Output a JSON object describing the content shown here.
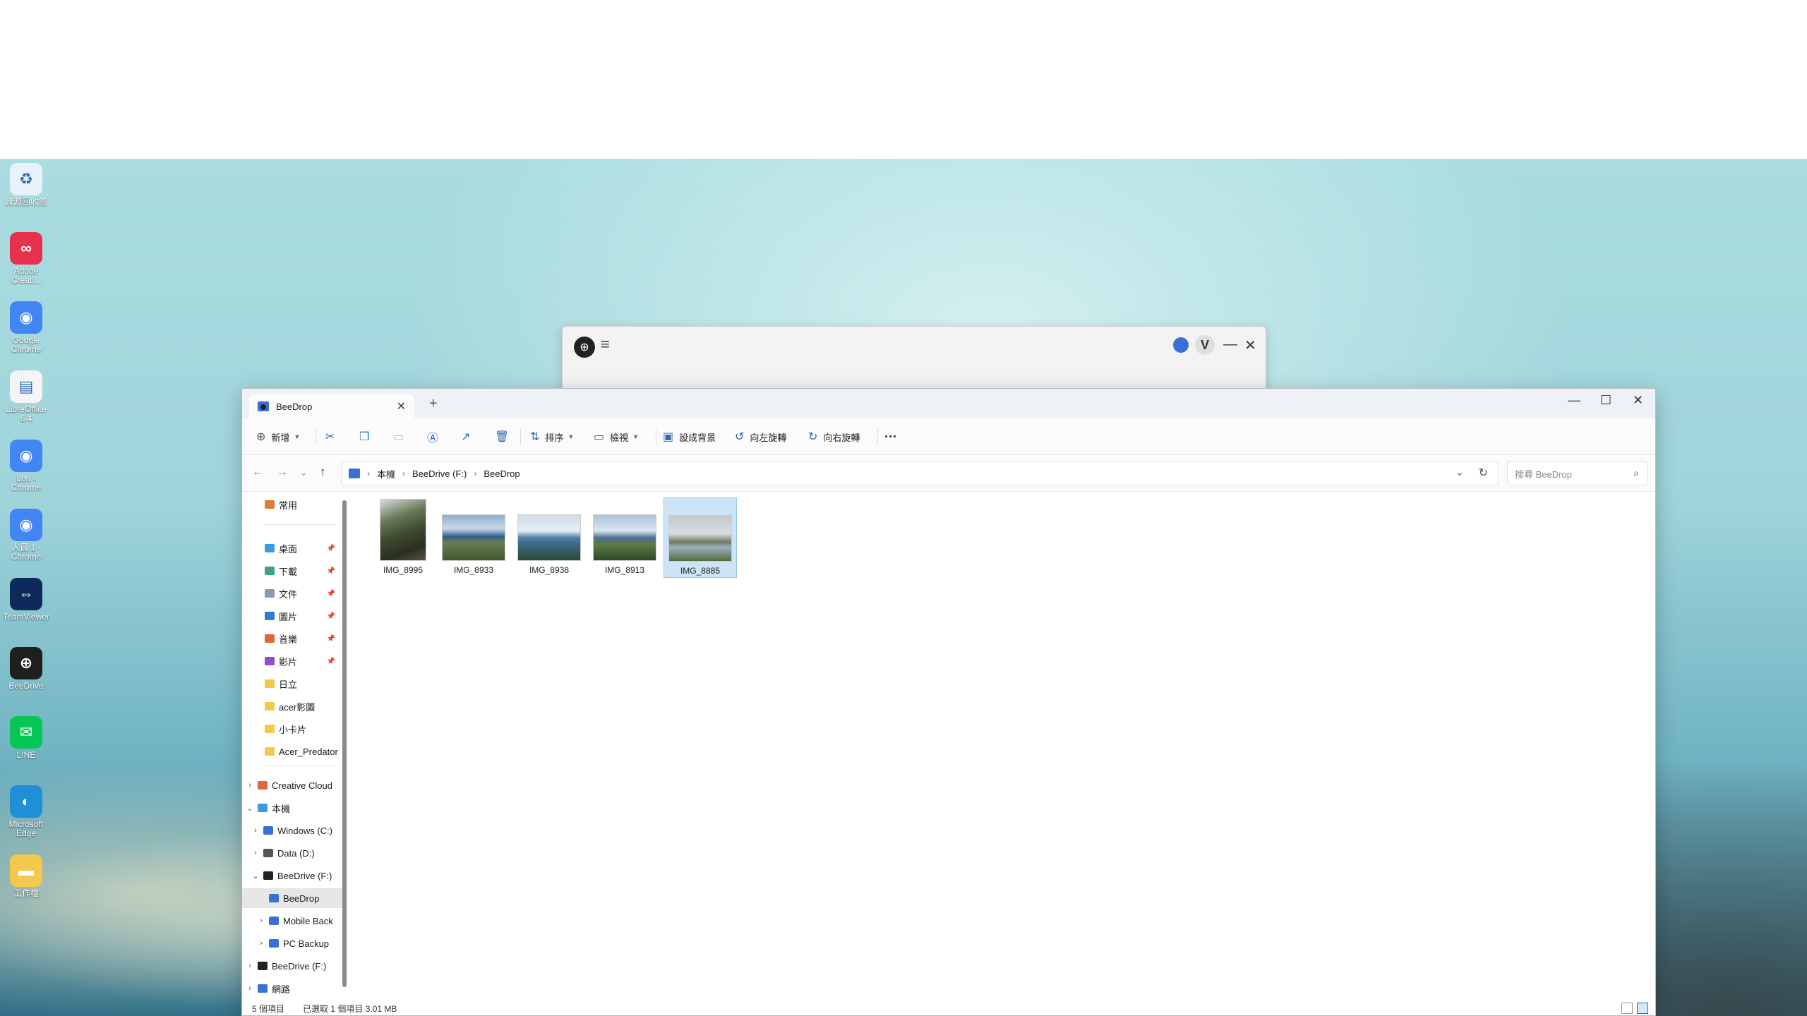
{
  "desktop": {
    "icons": [
      {
        "label": "資源回收筒",
        "icon": "recycle-bin-icon",
        "color": "#e8f2fb"
      },
      {
        "label": "Adobe Creati...",
        "icon": "creative-cloud-icon",
        "color": "#e6324f"
      },
      {
        "label": "Google Chrome",
        "icon": "chrome-icon",
        "color": "#4285f4"
      },
      {
        "label": "LibreOffice 6.4",
        "icon": "document-icon",
        "color": "#f4f4f4"
      },
      {
        "label": "Lori - Chrome",
        "icon": "chrome-profile-icon",
        "color": "#4285f4"
      },
      {
        "label": "人員 1 - Chrome",
        "icon": "chrome-profile-icon",
        "color": "#4285f4"
      },
      {
        "label": "TeamViewer",
        "icon": "teamviewer-icon",
        "color": "#0e2a5a"
      },
      {
        "label": "BeeDrive",
        "icon": "beedrive-icon",
        "color": "#1f1f1f"
      },
      {
        "label": "LINE",
        "icon": "line-icon",
        "color": "#06c755"
      },
      {
        "label": "Microsoft Edge",
        "icon": "edge-icon",
        "color": "#1f8fd8"
      },
      {
        "label": "工作檔",
        "icon": "folder-icon",
        "color": "#f2c94c"
      }
    ]
  },
  "beedrop_window": {
    "logo_glyph": "⊕",
    "menu_glyph": "≡",
    "avatar_letter": "V",
    "minimize_glyph": "—",
    "close_glyph": "✕"
  },
  "explorer": {
    "tab_title": "BeeDrop",
    "toolbar": {
      "new": "新增",
      "sort": "排序",
      "view": "檢視",
      "set_background": "設成背景",
      "rotate_left": "向左旋轉",
      "rotate_right": "向右旋轉",
      "more": "···"
    },
    "breadcrumb": [
      "本機",
      "BeeDrive (F:)",
      "BeeDrop"
    ],
    "search_placeholder": "搜尋 BeeDrop",
    "sidebar": {
      "home": "常用",
      "quick": [
        {
          "label": "桌面",
          "color": "#3a9be0",
          "pinned": "true"
        },
        {
          "label": "下載",
          "color": "#3aa67a",
          "pinned": "true"
        },
        {
          "label": "文件",
          "color": "#8a9bb5",
          "pinned": "true"
        },
        {
          "label": "圖片",
          "color": "#2e7ed0",
          "pinned": "true"
        },
        {
          "label": "音樂",
          "color": "#e0673a",
          "pinned": "true"
        },
        {
          "label": "影片",
          "color": "#8b4fc9",
          "pinned": "true"
        },
        {
          "label": "日立",
          "color": "#f2c94c",
          "pinned": "false"
        },
        {
          "label": "acer影圖",
          "color": "#f2c94c",
          "pinned": "false"
        },
        {
          "label": "小卡片",
          "color": "#f2c94c",
          "pinned": "false"
        },
        {
          "label": "Acer_Predator",
          "color": "#f2c94c",
          "pinned": "false"
        }
      ],
      "tree": [
        {
          "label": "Creative Cloud",
          "expander": "›",
          "indent": "0",
          "color": "#e0673a"
        },
        {
          "label": "本機",
          "expander": "⌄",
          "indent": "0",
          "color": "#3a9be0"
        },
        {
          "label": "Windows (C:)",
          "expander": "›",
          "indent": "1",
          "color": "#3a6fd8"
        },
        {
          "label": "Data (D:)",
          "expander": "›",
          "indent": "1",
          "color": "#555555"
        },
        {
          "label": "BeeDrive (F:)",
          "expander": "⌄",
          "indent": "1",
          "color": "#222222"
        },
        {
          "label": "BeeDrop",
          "expander": "",
          "indent": "2",
          "color": "#3a6fd8"
        },
        {
          "label": "Mobile Back",
          "expander": "›",
          "indent": "2",
          "color": "#3a6fd8"
        },
        {
          "label": "PC Backup",
          "expander": "›",
          "indent": "2",
          "color": "#3a6fd8"
        },
        {
          "label": "BeeDrive (F:)",
          "expander": "›",
          "indent": "0",
          "color": "#222222"
        },
        {
          "label": "網路",
          "expander": "›",
          "indent": "0",
          "color": "#3a6fd8"
        }
      ]
    },
    "files": [
      {
        "name": "IMG_8995",
        "kind": "portrait",
        "selected": "false"
      },
      {
        "name": "IMG_8933",
        "kind": "landscape",
        "selected": "false"
      },
      {
        "name": "IMG_8938",
        "kind": "landscape",
        "selected": "false"
      },
      {
        "name": "IMG_8913",
        "kind": "landscape",
        "selected": "false"
      },
      {
        "name": "IMG_8885",
        "kind": "landscape",
        "selected": "true"
      }
    ],
    "status": {
      "count": "5 個項目",
      "selection": "已選取 1 個項目  3.01 MB"
    }
  }
}
